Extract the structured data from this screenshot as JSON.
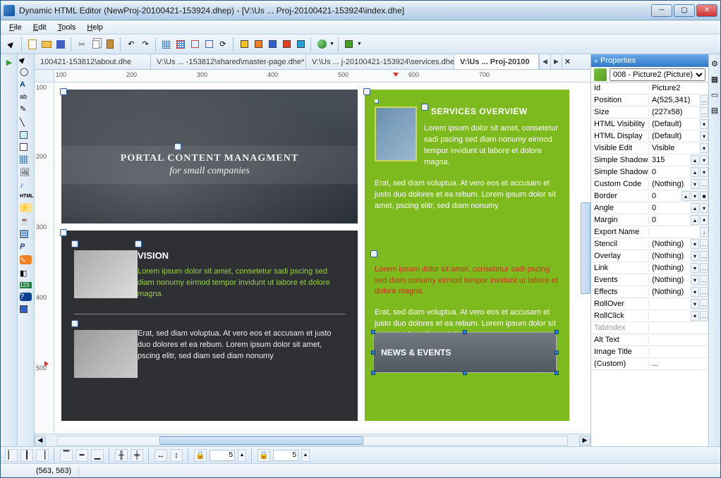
{
  "window": {
    "title": "Dynamic HTML Editor (NewProj-20100421-153924.dhep) - [V:\\Us ... Proj-20100421-153924\\index.dhe]"
  },
  "menu": {
    "file": "File",
    "edit": "Edit",
    "tools": "Tools",
    "help": "Help"
  },
  "tabs": [
    {
      "label": "100421-153812\\about.dhe"
    },
    {
      "label": "V:\\Us ... -153812\\shared\\master-page.dhe*"
    },
    {
      "label": "V:\\Us ... j-20100421-153924\\services.dhe"
    },
    {
      "label": "V:\\Us ... Proj-20100"
    }
  ],
  "ruler_h": [
    100,
    200,
    300,
    400,
    500,
    600,
    700
  ],
  "ruler_v": [
    100,
    200,
    300,
    400,
    500
  ],
  "design": {
    "portal": {
      "line1": "PORTAL CONTENT MANAGMENT",
      "line2": "for small companies"
    },
    "vision": {
      "heading": "VISION",
      "p1": "Lorem ipsum dolor sit amet, consetetur sadi pscing sed diam nonumy eirmod tempor invidunt ut labore et dolore magna.",
      "p2": "Erat, sed diam voluptua. At vero eos et accusam et justo duo dolores et ea rebum. Lorem ipsum dolor sit amet, pscing elitr, sed diam sed diam nonumy"
    },
    "services": {
      "heading": "SERVICES OVERVIEW",
      "p1": "Lorem ipsum dolor sit amet, consetetur sadi pscing sed diam nonumy eirmod tempor invidunt ut labore et dolore magna.",
      "p2": "Erat, sed diam voluptua. At vero eos et accusam et justo duo dolores et ea rebum. Lorem ipsum dolor sit amet, pscing elitr, sed diam nonumy"
    },
    "news": {
      "heading": "NEWS & EVENTS",
      "p1": "Lorem ipsum dolor sit amet, consetetur sadi pscing sed diam nonumy eirmod tempor invidunt ut labore et dolore magna.",
      "p2": "Erat, sed diam voluptua. At vero eos et accusam et justo duo dolores et ea rebum. Lorem ipsum dolor sit amet, pscing elitr, sed diam nonumy"
    }
  },
  "properties": {
    "panel_title": "Properties",
    "selector": "008 - Picture2 (Picture)",
    "rows": [
      {
        "k": "Id",
        "v": "Picture2",
        "btns": []
      },
      {
        "k": "Position",
        "v": "A(525,341)",
        "btns": [
          "..."
        ]
      },
      {
        "k": "Size",
        "v": "(227x58)",
        "btns": [
          "..."
        ]
      },
      {
        "k": "HTML Visibility",
        "v": "(Default)",
        "btns": [
          "▾"
        ]
      },
      {
        "k": "HTML Display",
        "v": "(Default)",
        "btns": [
          "▾"
        ]
      },
      {
        "k": "Visible Edit",
        "v": "Visible",
        "btns": [
          "▾"
        ]
      },
      {
        "k": "Simple Shadow",
        "v": "315",
        "btns": [
          "▴",
          "▾"
        ]
      },
      {
        "k": "Simple Shadow",
        "v": "0",
        "btns": [
          "▴",
          "▾"
        ]
      },
      {
        "k": "Custom Code",
        "v": "(Nothing)",
        "btns": [
          "▾",
          "..."
        ]
      },
      {
        "k": "Border",
        "v": "0",
        "btns": [
          "▴",
          "▾",
          "■"
        ]
      },
      {
        "k": "Angle",
        "v": "0",
        "btns": [
          "▴",
          "▾"
        ]
      },
      {
        "k": "Margin",
        "v": "0",
        "btns": [
          "▴",
          "▾"
        ]
      },
      {
        "k": "Export Name",
        "v": "",
        "btns": [
          "↓"
        ]
      },
      {
        "k": "Stencil",
        "v": "(Nothing)",
        "btns": [
          "▾",
          "..."
        ]
      },
      {
        "k": "Overlay",
        "v": "(Nothing)",
        "btns": [
          "▾",
          "..."
        ]
      },
      {
        "k": "Link",
        "v": "(Nothing)",
        "btns": [
          "▾",
          "..."
        ]
      },
      {
        "k": "Events",
        "v": "(Nothing)",
        "btns": [
          "▾",
          "..."
        ]
      },
      {
        "k": "Effects",
        "v": "(Nothing)",
        "btns": [
          "▾",
          "..."
        ]
      },
      {
        "k": "RollOver",
        "v": "",
        "btns": [
          "▾",
          "..."
        ]
      },
      {
        "k": "RollClick",
        "v": "",
        "btns": [
          "▾",
          "..."
        ]
      },
      {
        "k": "TabIndex",
        "v": "",
        "btns": [],
        "gray": true
      },
      {
        "k": "Alt Text",
        "v": "",
        "btns": []
      },
      {
        "k": "Image Title",
        "v": "",
        "btns": []
      },
      {
        "k": "(Custom)",
        "v": "...",
        "btns": []
      }
    ]
  },
  "bottom": {
    "spin1": "5",
    "spin2": "5"
  },
  "status": {
    "coords": "(563, 563)"
  }
}
